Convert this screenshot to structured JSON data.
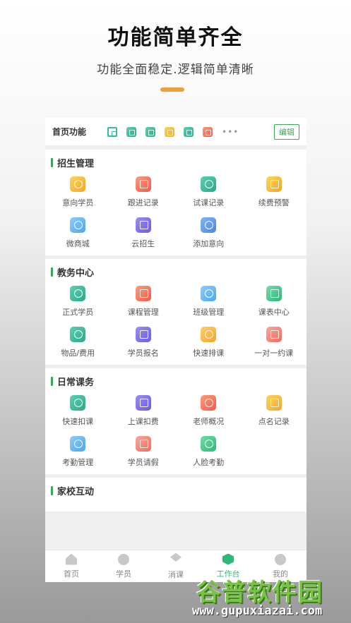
{
  "headline": "功能简单齐全",
  "subline": "功能全面稳定.逻辑简单清晰",
  "accent_color": "#f0a03a",
  "topbar": {
    "title": "首页功能",
    "mini_icons": [
      "qr-icon",
      "teal-icon",
      "teal-icon",
      "yellow-icon",
      "teal-icon",
      "red-icon"
    ],
    "more": "•••",
    "edit_label": "编辑"
  },
  "sections": [
    {
      "title": "招生管理",
      "items": [
        {
          "label": "意向学员",
          "icon": "user-icon",
          "color": "yellow"
        },
        {
          "label": "跟进记录",
          "icon": "clock-icon",
          "color": "red"
        },
        {
          "label": "试课记录",
          "icon": "headset-icon",
          "color": "teal"
        },
        {
          "label": "续费预警",
          "icon": "alert-icon",
          "color": "yellow"
        },
        {
          "label": "微商城",
          "icon": "shop-icon",
          "color": "blue"
        },
        {
          "label": "云招生",
          "icon": "user-card-icon",
          "color": "purple"
        },
        {
          "label": "添加意向",
          "icon": "add-user-icon",
          "color": "slate"
        }
      ]
    },
    {
      "title": "教务中心",
      "items": [
        {
          "label": "正式学员",
          "icon": "student-icon",
          "color": "teal"
        },
        {
          "label": "课程管理",
          "icon": "layers-icon",
          "color": "red"
        },
        {
          "label": "班级管理",
          "icon": "class-icon",
          "color": "blue"
        },
        {
          "label": "课表中心",
          "icon": "calendar-icon",
          "color": "green"
        },
        {
          "label": "物品/费用",
          "icon": "box-icon",
          "color": "teal"
        },
        {
          "label": "学员报名",
          "icon": "signup-icon",
          "color": "purple"
        },
        {
          "label": "快速排课",
          "icon": "schedule-icon",
          "color": "orange"
        },
        {
          "label": "一对一约课",
          "icon": "one-to-one-icon",
          "color": "pink"
        }
      ]
    },
    {
      "title": "日常课务",
      "items": [
        {
          "label": "快速扣课",
          "icon": "lightning-icon",
          "color": "teal"
        },
        {
          "label": "上课扣费",
          "icon": "money-bag-icon",
          "color": "purple"
        },
        {
          "label": "老师概况",
          "icon": "teacher-icon",
          "color": "red"
        },
        {
          "label": "点名记录",
          "icon": "rollcall-icon",
          "color": "yellow"
        },
        {
          "label": "考勤管理",
          "icon": "printer-icon",
          "color": "blue"
        },
        {
          "label": "学员请假",
          "icon": "leave-icon",
          "color": "pink"
        },
        {
          "label": "人脸考勤",
          "icon": "face-icon",
          "color": "green"
        }
      ]
    },
    {
      "title": "家校互动",
      "items": []
    }
  ],
  "tabbar": [
    {
      "label": "首页",
      "icon": "home-icon",
      "active": false
    },
    {
      "label": "学员",
      "icon": "user-icon",
      "active": false
    },
    {
      "label": "消课",
      "icon": "layers-icon",
      "active": false
    },
    {
      "label": "工作台",
      "icon": "workbench-icon",
      "active": true
    },
    {
      "label": "我的",
      "icon": "profile-icon",
      "active": false
    }
  ],
  "watermark": {
    "main": "谷普软件园",
    "url": "www.gupuxiazai.com"
  }
}
